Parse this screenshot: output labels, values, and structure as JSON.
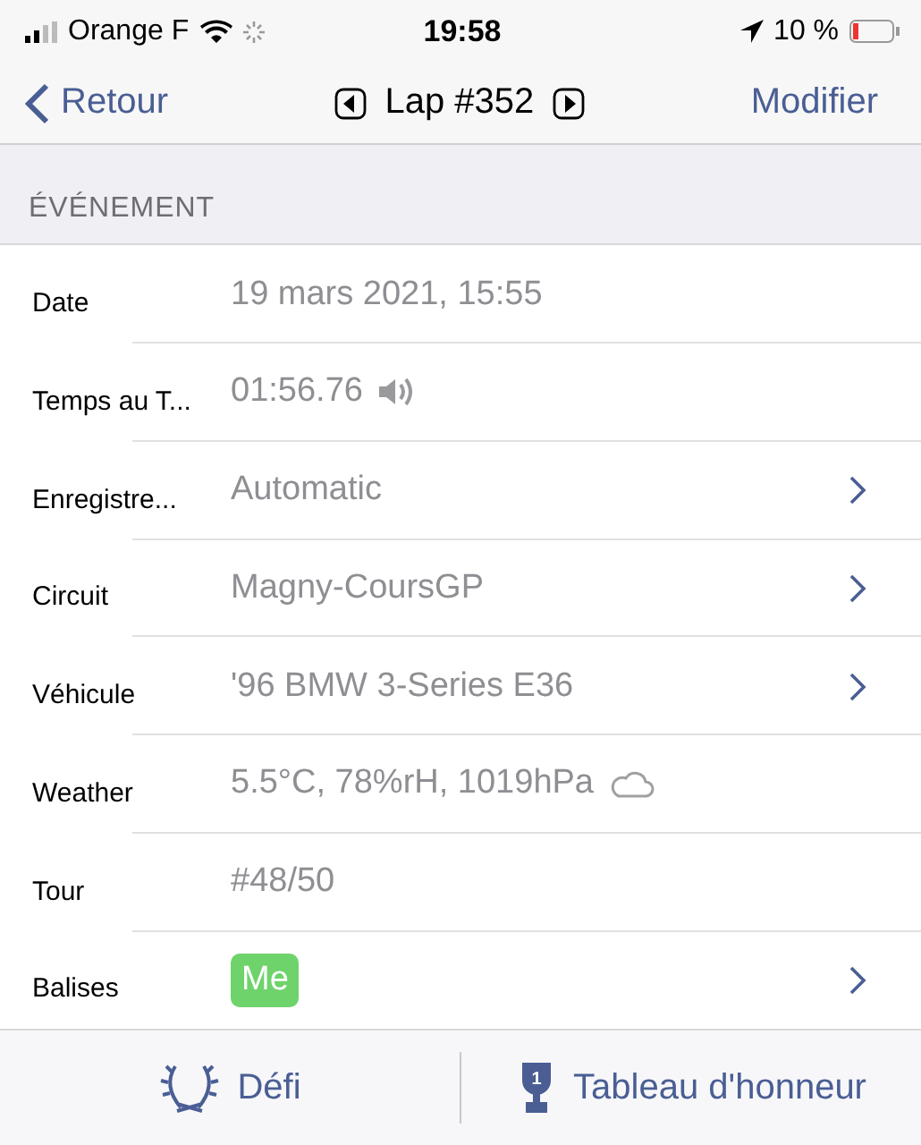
{
  "status_bar": {
    "carrier": "Orange F",
    "time": "19:58",
    "battery": "10 %"
  },
  "nav": {
    "back": "Retour",
    "title": "Lap #352",
    "edit": "Modifier"
  },
  "section": {
    "title": "ÉVÉNEMENT"
  },
  "rows": [
    {
      "label": "Date",
      "value": "19 mars 2021, 15:55",
      "kind": "text",
      "disclosure": false
    },
    {
      "label": "Temps au T...",
      "value": "01:56.76",
      "kind": "sound",
      "disclosure": false
    },
    {
      "label": "Enregistre...",
      "value": "Automatic",
      "kind": "text",
      "disclosure": true
    },
    {
      "label": "Circuit",
      "value": "Magny-CoursGP",
      "kind": "text",
      "disclosure": true
    },
    {
      "label": "Véhicule",
      "value": "'96 BMW 3-Series E36",
      "kind": "text",
      "disclosure": true
    },
    {
      "label": "Weather",
      "value": "5.5°C, 78%rH, 1019hPa",
      "kind": "weather",
      "disclosure": false
    },
    {
      "label": "Tour",
      "value": "#48/50",
      "kind": "text",
      "disclosure": false
    },
    {
      "label": "Balises",
      "value": "Me",
      "kind": "tag",
      "color": "#6fd36b",
      "disclosure": true
    }
  ],
  "toolbar": [
    {
      "label": "Défi",
      "kind": "laurel"
    },
    {
      "label": "Tableau d'honneur",
      "kind": "trophy",
      "badge": "1"
    }
  ]
}
